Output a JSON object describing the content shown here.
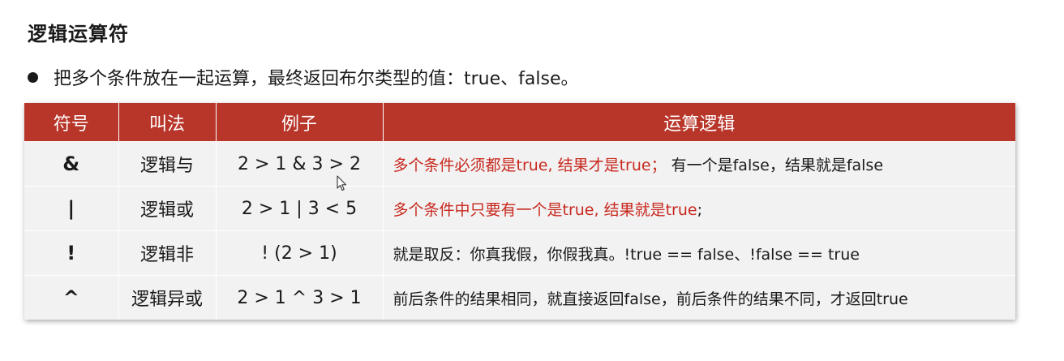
{
  "title": "逻辑运算符",
  "bullet": "把多个条件放在一起运算，最终返回布尔类型的值：true、false。",
  "table": {
    "headers": [
      "符号",
      "叫法",
      "例子",
      "运算逻辑"
    ],
    "rows": [
      {
        "symbol": "&",
        "name": "逻辑与",
        "example": "2 > 1 & 3 > 2",
        "logic": [
          {
            "text": "多个条件必须都是true, 结果才是true；",
            "red": true
          },
          {
            "text": "    有一个是false，结果就是false",
            "red": false
          }
        ]
      },
      {
        "symbol": "|",
        "name": "逻辑或",
        "example": "2 > 1 |  3 < 5",
        "logic": [
          {
            "text": "多个条件中只要有一个是true, 结果就是true",
            "red": true
          },
          {
            "text": ";",
            "red": false
          }
        ]
      },
      {
        "symbol": "!",
        "name": "逻辑非",
        "example": "! (2 > 1)",
        "logic": [
          {
            "text": "就是取反：你真我假，你假我真。!true == false、!false == true",
            "red": false
          }
        ]
      },
      {
        "symbol": "^",
        "name": "逻辑异或",
        "example": "2 > 1 ^ 3 > 1",
        "logic": [
          {
            "text": "前后条件的结果相同，就直接返回false，前后条件的结果不同，才返回true",
            "red": false
          }
        ]
      }
    ]
  },
  "colors": {
    "header_bg": "#b8352a",
    "row_bg": "#f2f2f2",
    "highlight_text": "#c8281e"
  },
  "icons": {
    "bullet": "bullet-dot-icon",
    "cursor": "mouse-pointer-icon"
  }
}
